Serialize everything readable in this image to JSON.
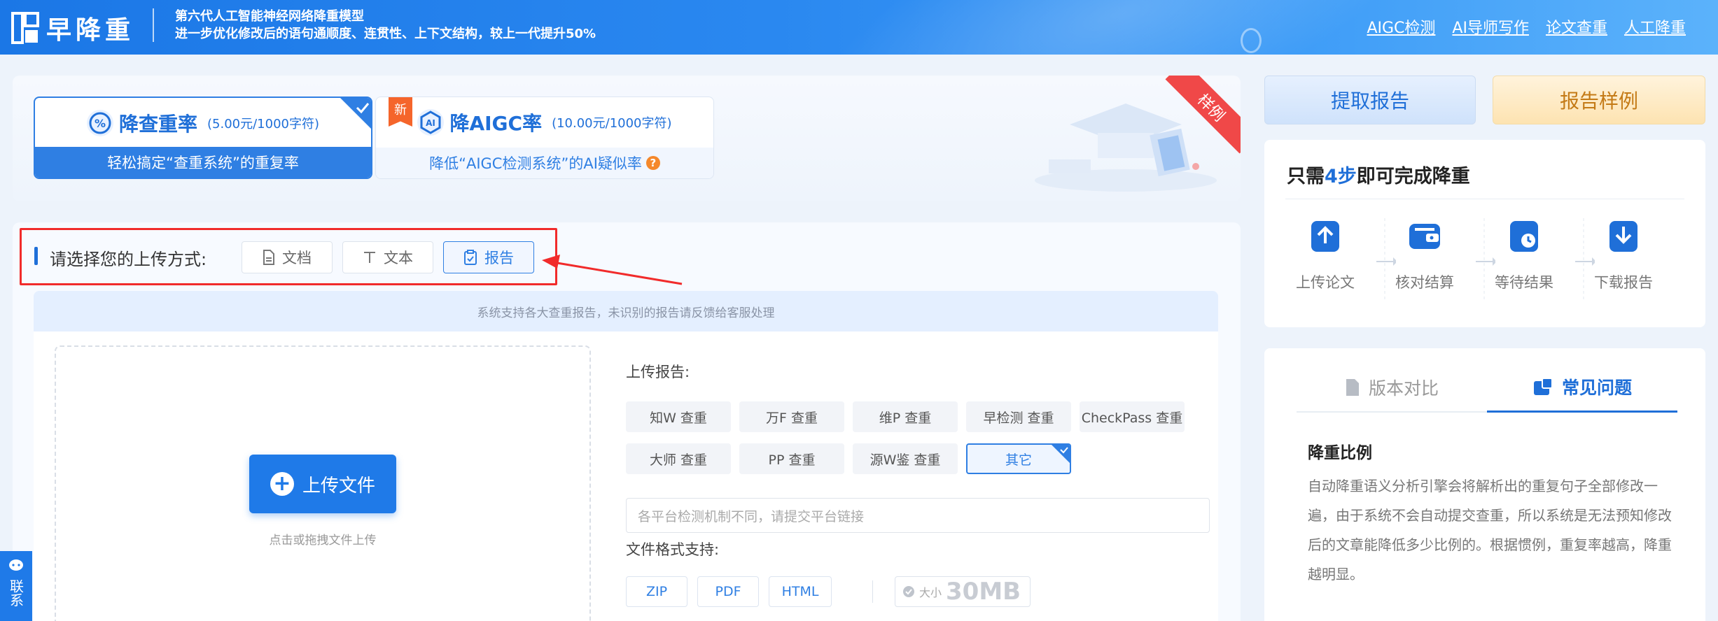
{
  "header": {
    "brand": "早降重",
    "slogan_line1": "第六代人工智能神经网络降重模型",
    "slogan_line2": "进一步优化修改后的语句通顺度、连贯性、上下文结构，较上一代提升50%",
    "nav": [
      "AIGC检测",
      "AI导师写作",
      "论文查重",
      "人工降重"
    ]
  },
  "plans": {
    "active": {
      "name": "降查重率",
      "price": "(5.00元/1000字符)",
      "desc": "轻松搞定“查重系统”的重复率"
    },
    "inactive": {
      "tag": "新",
      "name": "降AIGC率",
      "price": "(10.00元/1000字符)",
      "desc": "降低“AIGC检测系统”的AI疑似率",
      "help": "?"
    },
    "ribbon": "样例"
  },
  "upload": {
    "label": "请选择您的上传方式:",
    "modes": [
      "文档",
      "文本",
      "报告"
    ],
    "selected": "报告",
    "notice": "系统支持各大查重报告，未识别的报告请反馈给客服处理",
    "button": "上传文件",
    "hint": "点击或拖拽文件上传"
  },
  "report_form": {
    "label": "上传报告:",
    "platforms": [
      "知W 查重",
      "万F 查重",
      "维P 查重",
      "早检测 查重",
      "CheckPass 查重",
      "大师 查重",
      "PP 查重",
      "源W鉴 查重",
      "其它"
    ],
    "selected_platform": "其它",
    "link_placeholder": "各平台检测机制不同，请提交平台链接",
    "format_label": "文件格式支持:",
    "formats": [
      "ZIP",
      "PDF",
      "HTML"
    ],
    "size_caption": "大小",
    "size_value": "30MB"
  },
  "sidebar": {
    "report_button": "提取报告",
    "sample_button": "报告样例",
    "steps_title_pre": "只需",
    "steps_title_num": "4步",
    "steps_title_post": "即可完成降重",
    "steps": [
      "上传论文",
      "核对结算",
      "等待结果",
      "下载报告"
    ],
    "tabs": [
      "版本对比",
      "常见问题"
    ],
    "active_tab": "常见问题",
    "faq_title": "降重比例",
    "faq_text": "自动降重语义分析引擎会将解析出的重复句子全部修改一遍，由于系统不会自动提交查重，所以系统是无法预知修改后的文章能降低多少比例的。根据惯例，重复率越高，降重越明显。"
  },
  "contact": {
    "label": "联系"
  },
  "colors": {
    "primary": "#1f7ae8",
    "highlight_border": "#f12b2b",
    "accent_orange": "#f5652b"
  }
}
